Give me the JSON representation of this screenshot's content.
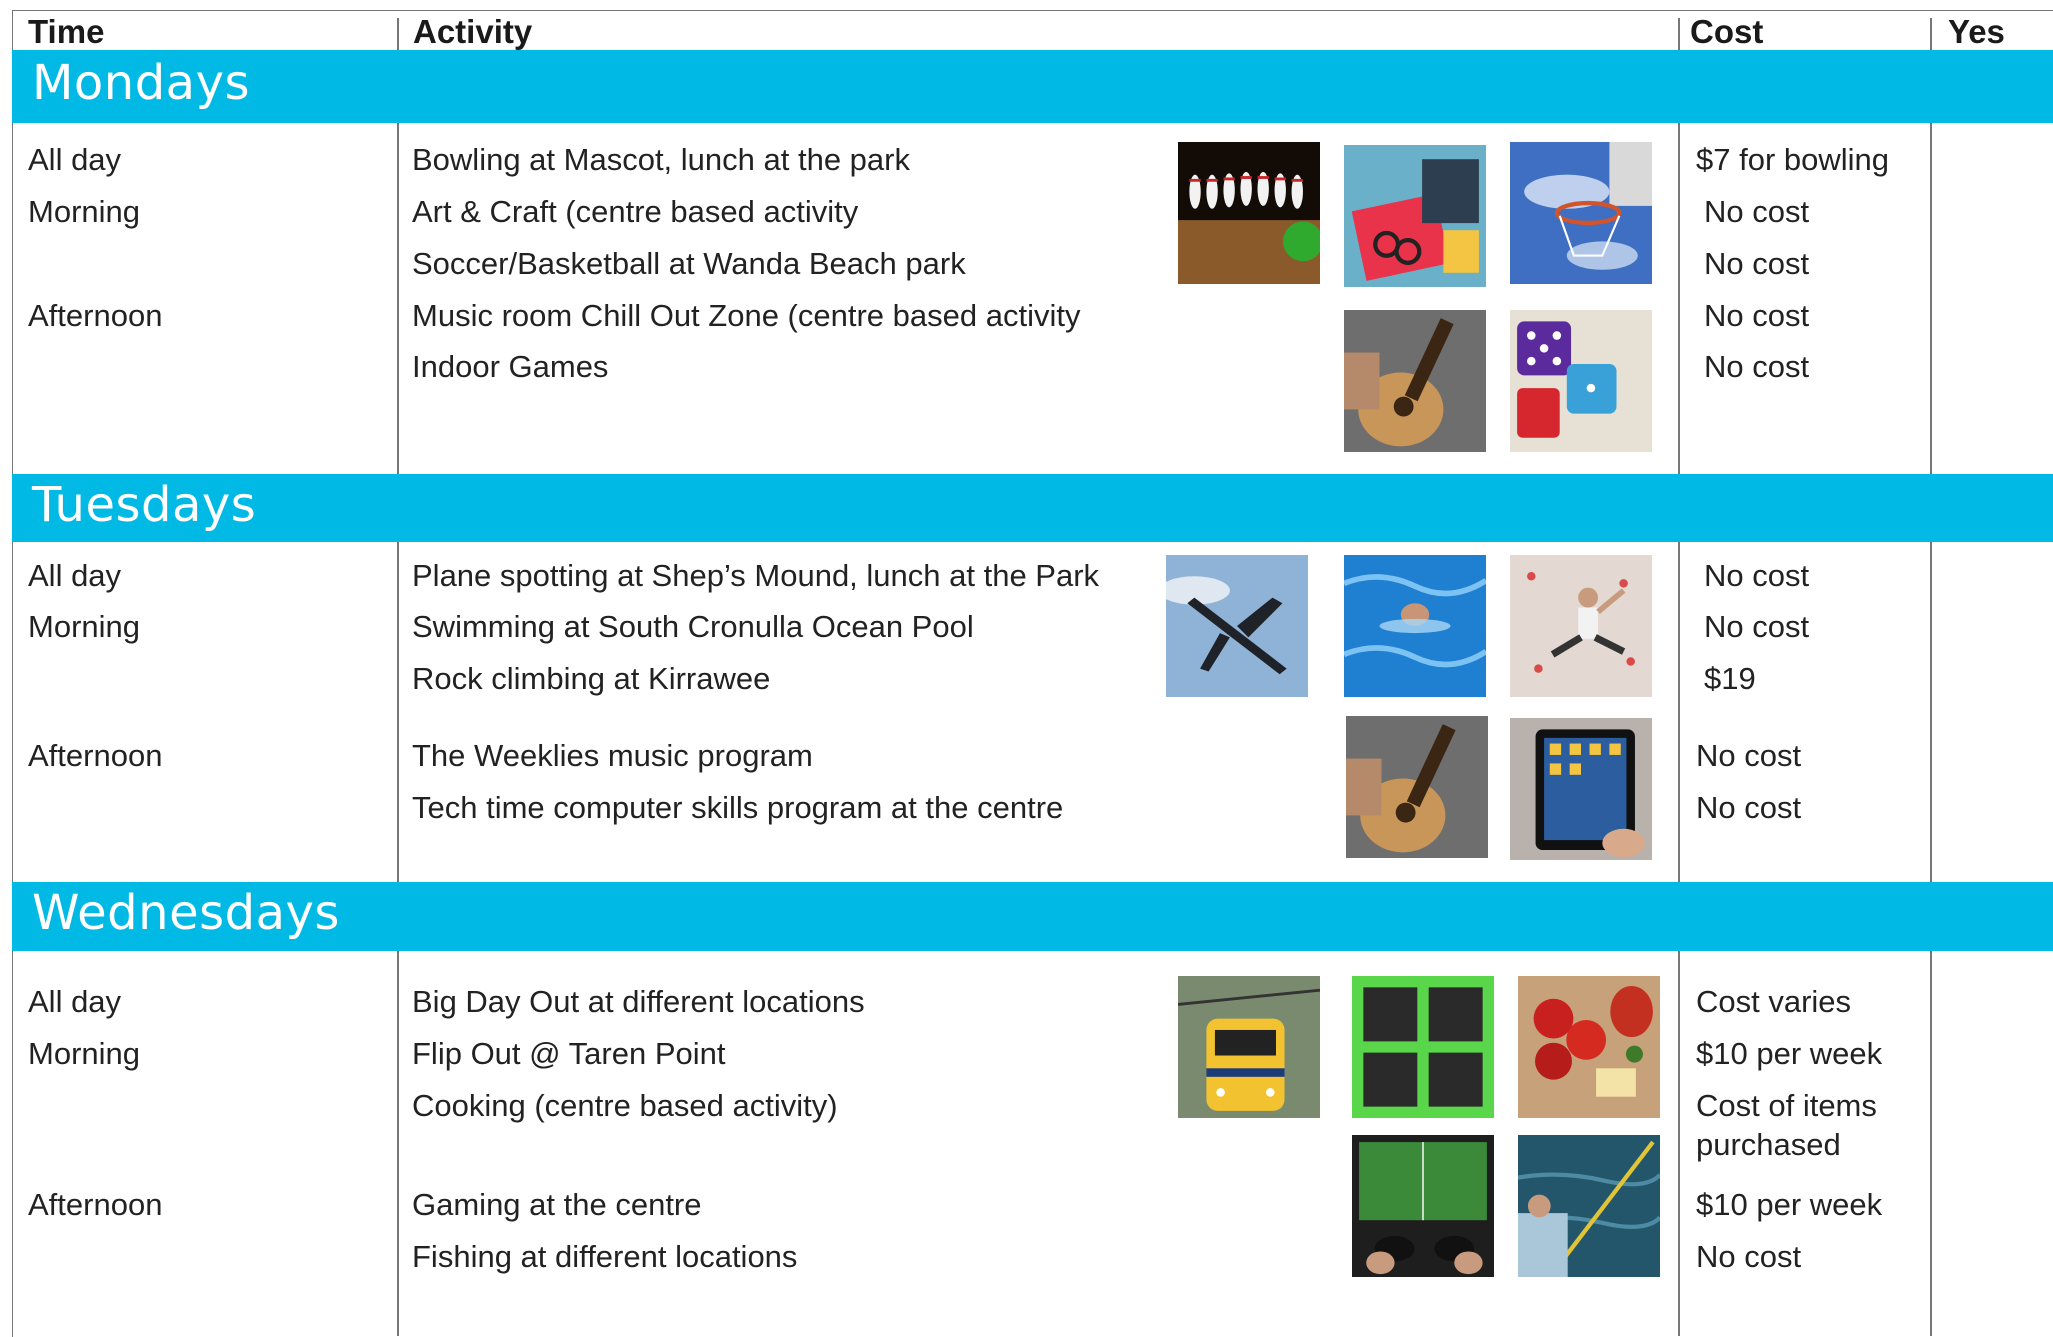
{
  "headers": {
    "time": "Time",
    "activity": "Activity",
    "cost": "Cost",
    "yes": "Yes"
  },
  "days": [
    {
      "name": "Mondays",
      "rows": [
        {
          "time": "All day",
          "activity": "Bowling at Mascot, lunch at the park",
          "cost": "$7 for bowling"
        },
        {
          "time": "Morning",
          "activity": "Art & Craft (centre based activity",
          "cost": "No cost"
        },
        {
          "time": "",
          "activity": "Soccer/Basketball at Wanda Beach park",
          "cost": "No cost"
        },
        {
          "time": "Afternoon",
          "activity": "Music room Chill Out Zone  (centre based activity",
          "cost": "No cost"
        },
        {
          "time": "",
          "activity": "Indoor Games",
          "cost": "No cost"
        }
      ],
      "images": [
        "bowling-pins-photo",
        "art-supplies-photo",
        "basketball-hoop-photo",
        "acoustic-guitar-photo",
        "dice-photo"
      ]
    },
    {
      "name": "Tuesdays",
      "rows": [
        {
          "time": "All day",
          "activity": "Plane spotting at Shep’s Mound, lunch at the Park",
          "cost": "No cost"
        },
        {
          "time": "Morning",
          "activity": "Swimming at South Cronulla Ocean Pool",
          "cost": "No cost"
        },
        {
          "time": "",
          "activity": "Rock climbing at Kirrawee",
          "cost": "$19"
        },
        {
          "time": "Afternoon",
          "activity": "The Weeklies music program",
          "cost": "No cost"
        },
        {
          "time": "",
          "activity": "Tech time computer skills program at the centre",
          "cost": "No cost"
        }
      ],
      "images": [
        "airplane-photo",
        "swimmer-photo",
        "rock-climber-photo",
        "acoustic-guitar-photo",
        "tablet-photo"
      ]
    },
    {
      "name": "Wednesdays",
      "rows": [
        {
          "time": "All day",
          "activity": "Big Day Out at different locations",
          "cost": "Cost varies"
        },
        {
          "time": "Morning",
          "activity": "Flip Out @ Taren Point",
          "cost": "$10 per week"
        },
        {
          "time": "",
          "activity": "Cooking (centre based activity)",
          "cost": "Cost of items"
        },
        {
          "time": "",
          "activity": "",
          "cost": "purchased"
        },
        {
          "time": "Afternoon",
          "activity": "Gaming at the centre",
          "cost": "$10 per week"
        },
        {
          "time": "",
          "activity": "Fishing at different locations",
          "cost": "No cost"
        }
      ],
      "images": [
        "train-photo",
        "trampoline-photo",
        "cooking-ingredients-photo",
        "video-gaming-photo",
        "fishing-photo"
      ]
    }
  ],
  "colors": {
    "band": "#00b9e4",
    "grid": "#777777"
  }
}
